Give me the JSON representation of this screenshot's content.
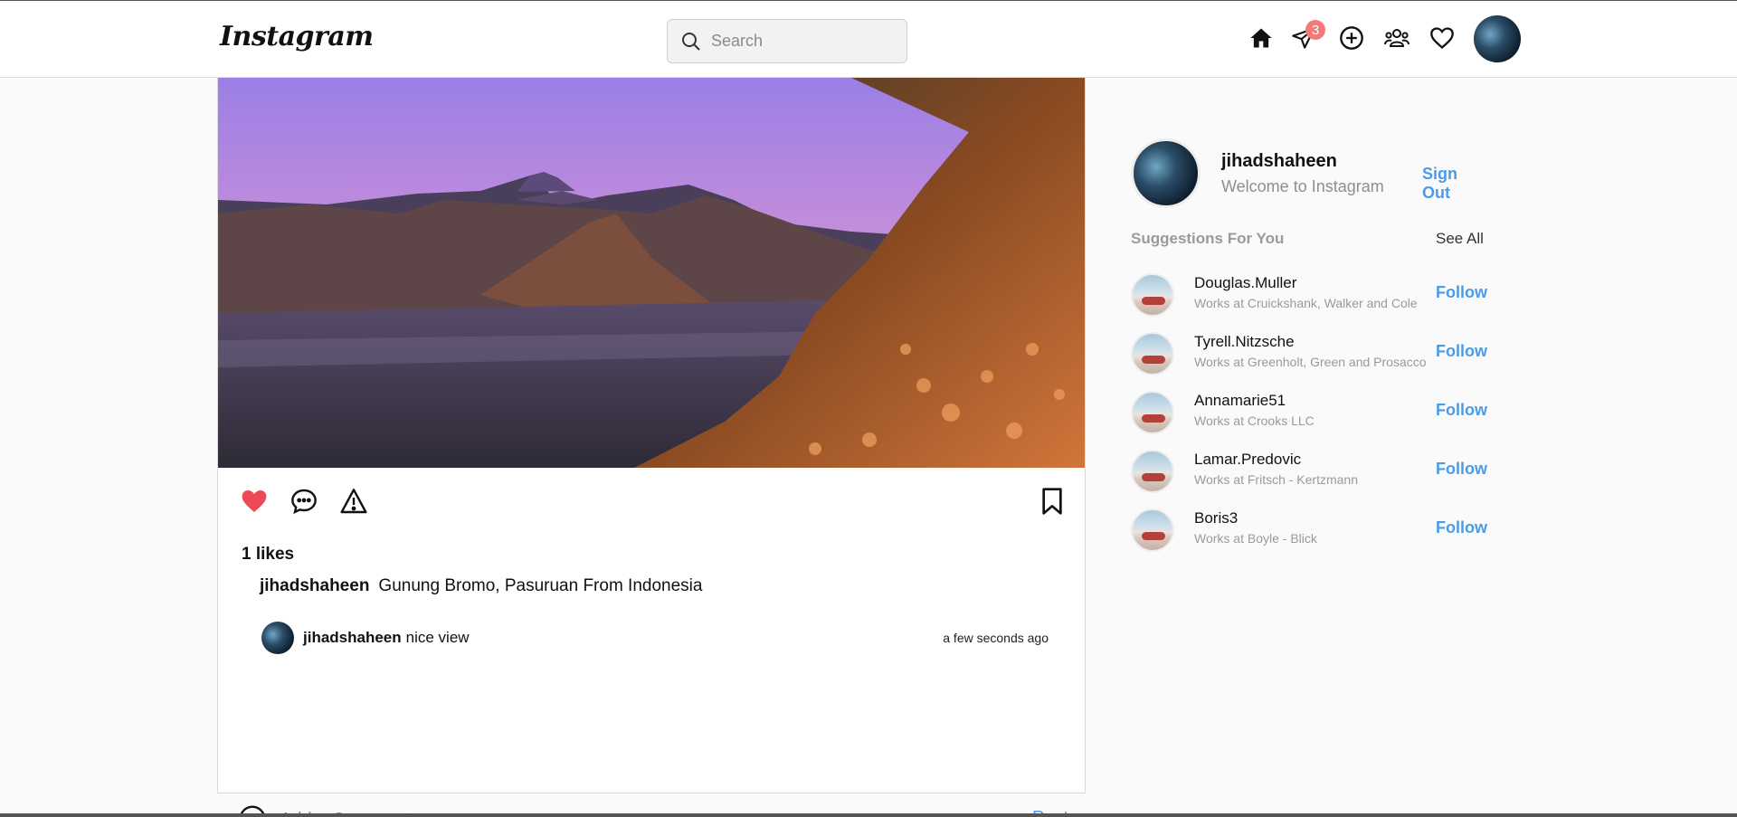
{
  "app": {
    "logo": "Instagram"
  },
  "search": {
    "placeholder": "Search"
  },
  "nav": {
    "messages_badge": "3",
    "icons": [
      "home-icon",
      "paper-plane-icon",
      "plus-circle-icon",
      "people-icon",
      "heart-icon"
    ]
  },
  "post": {
    "likes": "1 likes",
    "author": "jihadshaheen",
    "caption": "Gunung Bromo, Pasuruan From Indonesia",
    "liked": true,
    "comments": [
      {
        "user": "jihadshaheen",
        "text": "nice view",
        "time": "a few seconds ago"
      }
    ],
    "add_comment_placeholder": "Add a Comment",
    "post_label": "Post"
  },
  "profile": {
    "username": "jihadshaheen",
    "subtitle": "Welcome to Instagram",
    "signout_label": "Sign Out"
  },
  "suggestions": {
    "title": "Suggestions For You",
    "see_all": "See All",
    "follow_label": "Follow",
    "items": [
      {
        "name": "Douglas.Muller",
        "info": "Works at Cruickshank, Walker and Cole"
      },
      {
        "name": "Tyrell.Nitzsche",
        "info": "Works at Greenholt, Green and Prosacco"
      },
      {
        "name": "Annamarie51",
        "info": "Works at Crooks LLC"
      },
      {
        "name": "Lamar.Predovic",
        "info": "Works at Fritsch - Kertzmann"
      },
      {
        "name": "Boris3",
        "info": "Works at Boyle - Blick"
      }
    ]
  },
  "colors": {
    "accent": "#4a9be8",
    "like": "#ed4956",
    "badge": "#f47a7a"
  }
}
